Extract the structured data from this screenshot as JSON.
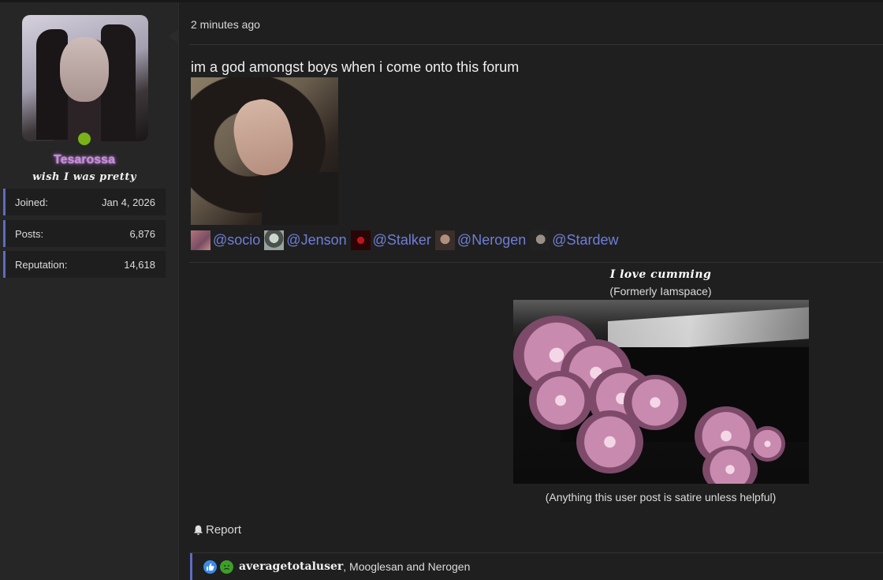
{
  "user": {
    "username": "Tesarossa",
    "title": "wish I was pretty",
    "status": "online",
    "stats": [
      {
        "label": "Joined:",
        "value": "Jan 4, 2026"
      },
      {
        "label": "Posts:",
        "value": "6,876"
      },
      {
        "label": "Reputation:",
        "value": "14,618"
      }
    ]
  },
  "post": {
    "timestamp": "2 minutes ago",
    "text": "im a god amongst boys when i come onto this forum",
    "mentions": [
      {
        "handle": "@socio",
        "avatar": "socio-avatar"
      },
      {
        "handle": "@Jenson",
        "avatar": "jenson-avatar"
      },
      {
        "handle": "@Stalker",
        "avatar": "stalker-avatar"
      },
      {
        "handle": "@Nerogen",
        "avatar": "nerogen-avatar"
      },
      {
        "handle": "@Stardew",
        "avatar": "stardew-avatar"
      }
    ]
  },
  "signature": {
    "title": "I love cumming",
    "former": "(Formerly Iamspace)",
    "footer": "(Anything this user post is satire unless helpful)"
  },
  "actions": {
    "report_label": "Report",
    "report_icon": "bell-icon"
  },
  "reactions": {
    "icons": [
      "like-icon",
      "sick-icon"
    ],
    "first_user": "averagetotaluser",
    "rest": ", Mooglesan and Nerogen"
  },
  "colors": {
    "accent": "#5e6bc4",
    "mention": "#6f7ed8",
    "online": "#7ab317",
    "username_glow": "#c78fd8"
  }
}
